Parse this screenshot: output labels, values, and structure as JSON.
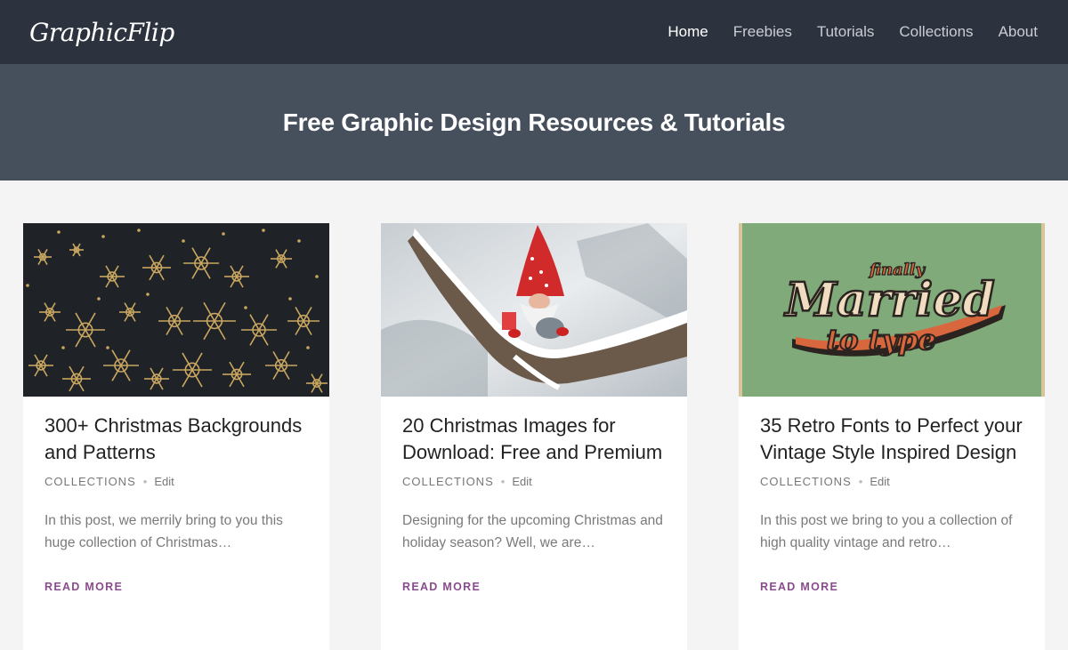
{
  "header": {
    "logo": "GraphicFlip",
    "nav": [
      "Home",
      "Freebies",
      "Tutorials",
      "Collections",
      "About"
    ],
    "active_nav": "Home"
  },
  "hero": {
    "title": "Free Graphic Design Resources & Tutorials"
  },
  "posts": [
    {
      "title": "300+ Christmas Backgrounds and Patterns",
      "category": "COLLECTIONS",
      "edit": "Edit",
      "excerpt": "In this post, we merrily bring to you this huge collection of Christmas…",
      "read_more": "READ MORE",
      "image": "gold-snowflakes-on-dark-background"
    },
    {
      "title": "20 Christmas Images for Download: Free and Premium",
      "category": "COLLECTIONS",
      "edit": "Edit",
      "excerpt": "Designing for the upcoming Christmas and holiday season? Well, we are…",
      "read_more": "READ MORE",
      "image": "gnome-on-snowy-branch"
    },
    {
      "title": "35 Retro Fonts to Perfect your Vintage Style Inspired Design",
      "category": "COLLECTIONS",
      "edit": "Edit",
      "excerpt": "In this post we bring to you a collection of high quality vintage and retro…",
      "read_more": "READ MORE",
      "image": "retro-typography-poster",
      "image_text": {
        "line1": "finally",
        "line2": "Married",
        "line3": "to type"
      }
    }
  ],
  "colors": {
    "header_bg": "#2d333e",
    "hero_bg": "#464f5c",
    "page_bg": "#f4f4f4",
    "accent": "#8a4b8e"
  }
}
